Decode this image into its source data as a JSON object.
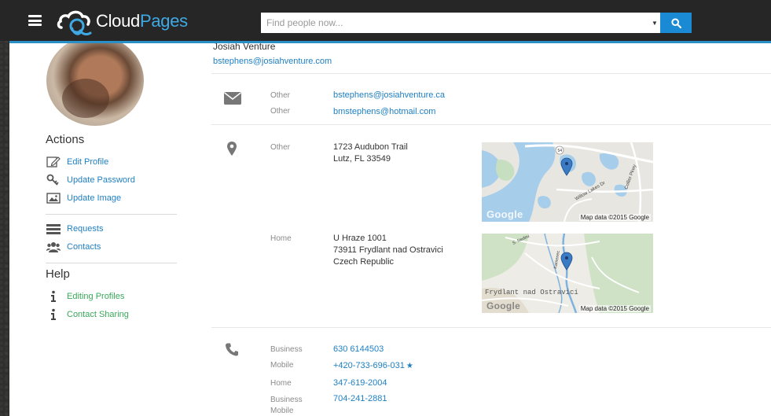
{
  "app": {
    "logo_prefix": "Cloud",
    "logo_suffix": "Pages"
  },
  "search": {
    "placeholder": "Find people now..."
  },
  "profile": {
    "organization": "Josiah Venture",
    "primary_email": "bstephens@josiahventure.com"
  },
  "sidebar": {
    "actions_heading": "Actions",
    "actions": [
      {
        "label": "Edit Profile",
        "icon": "edit-icon"
      },
      {
        "label": "Update Password",
        "icon": "key-icon"
      },
      {
        "label": "Update Image",
        "icon": "image-icon"
      }
    ],
    "nav": [
      {
        "label": "Requests",
        "icon": "requests-icon"
      },
      {
        "label": "Contacts",
        "icon": "contacts-icon"
      }
    ],
    "help_heading": "Help",
    "help": [
      {
        "label": "Editing Profiles",
        "icon": "info-icon"
      },
      {
        "label": "Contact Sharing",
        "icon": "info-icon"
      }
    ]
  },
  "emails": [
    {
      "type": "Other",
      "value": "bstephens@josiahventure.ca"
    },
    {
      "type": "Other",
      "value": "bmstephens@hotmail.com"
    }
  ],
  "addresses": [
    {
      "type": "Other",
      "line1": "1723 Audubon Trail",
      "line2": "Lutz, FL 33549",
      "line3": "",
      "map_caption": "Map data ©2015 Google",
      "map_watermark": "Google",
      "map_road_label": "Willow Lakes Dr",
      "map_road_label2": "Collier Pkwy",
      "map_route": "54"
    },
    {
      "type": "Home",
      "line1": "U Hraze 1001",
      "line2": "73911 Frydlant nad Ostravici",
      "line3": "Czech Republic",
      "map_caption": "Map data ©2015 Google",
      "map_watermark": "Google",
      "map_place_label": "Frydlant nad Ostravici",
      "map_road_label": "Kamenec",
      "map_road_label2": "S. Nedeu"
    }
  ],
  "phones": [
    {
      "type": "Business",
      "value": "630 6144503",
      "starred": false
    },
    {
      "type": "Mobile",
      "value": "+420-733-696-031",
      "starred": true
    },
    {
      "type": "Home",
      "value": "347-619-2004",
      "starred": false
    },
    {
      "type": "Business Mobile",
      "value": "704-241-2881",
      "starred": false
    }
  ],
  "colors": {
    "accent": "#2a8fc7",
    "link": "#1e7fc1",
    "help_link": "#3aa85a",
    "topbar": "#262626",
    "search_button": "#1a8ad4"
  }
}
